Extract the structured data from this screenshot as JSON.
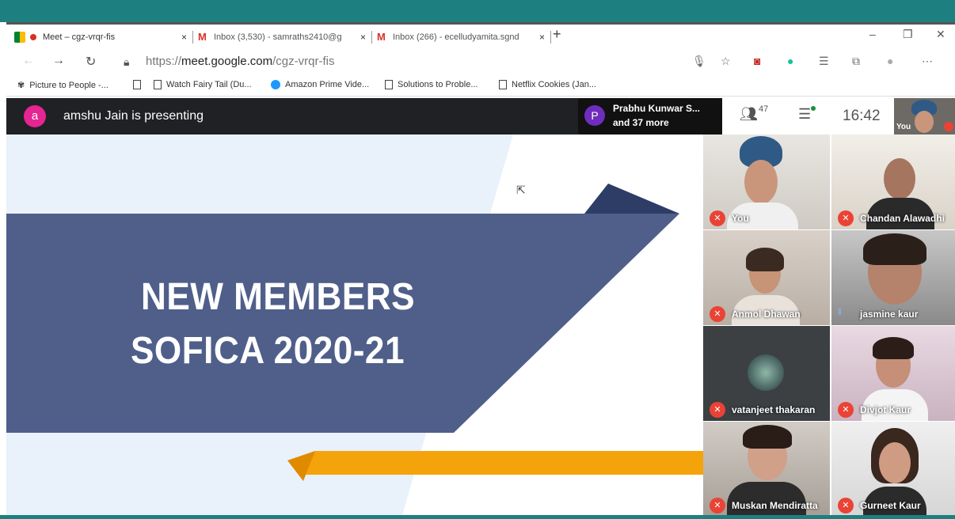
{
  "browser": {
    "tabs": [
      {
        "label": "Meet – cgz-vrqr-fis",
        "close": "×"
      },
      {
        "label": "Inbox (3,530) - samraths2410@g",
        "close": "×"
      },
      {
        "label": "Inbox (266) - ecelludyamita.sgnd",
        "close": "×"
      }
    ],
    "new_tab": "+",
    "url_prefix": "https://",
    "url_domain": "meet.google.com",
    "url_path": "/cgz-vrqr-fis",
    "bookmarks": [
      "Picture to People -...",
      "Watch Fairy Tail (Du...",
      "Amazon Prime Vide...",
      "Solutions to Proble...",
      "Netflix Cookies (Jan..."
    ]
  },
  "meet": {
    "presenter_initial": "a",
    "presenting_text": "amshu Jain is presenting",
    "chip_initial": "P",
    "chip_name": "Prabhu Kunwar S...",
    "chip_more": "and 37 more",
    "participant_count": "47",
    "time": "16:42",
    "self_label": "You"
  },
  "slide": {
    "line1": "NEW MEMBERS",
    "line2": "SOFICA 2020-21",
    "colors": {
      "band": "#4f5f8a",
      "accent": "#f5a30a",
      "dark": "#3a4a72",
      "bg": "#e9f1fa"
    }
  },
  "participants": [
    {
      "name": "You",
      "muted": true
    },
    {
      "name": "Chandan Alawadhi",
      "muted": true
    },
    {
      "name": "Anmol Dhawan",
      "muted": true
    },
    {
      "name": "jasmine kaur",
      "muted": false
    },
    {
      "name": "vatanjeet thakaran",
      "muted": true
    },
    {
      "name": "Divjot Kaur",
      "muted": true
    },
    {
      "name": "Muskan Mendiratta",
      "muted": true
    },
    {
      "name": "Gurneet Kaur",
      "muted": true
    }
  ]
}
